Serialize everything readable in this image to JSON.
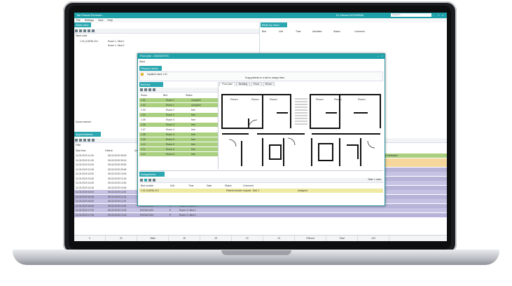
{
  "app": {
    "title": "Tab Pascal Schemer...",
    "menu": [
      "File",
      "Settings",
      "View",
      "Help"
    ],
    "user_label": "Dr. Kalman KATHARINA",
    "search_placeholder": "Search...",
    "accent": "#1ea0a8"
  },
  "left_panel": {
    "title": "Ward view",
    "filter_label": "Ward code",
    "tree_item": "1.01 (CARE) 012",
    "tree_sub": [
      "Room 1 / Bed 1",
      "Room 1 / Bed 2"
    ],
    "footer": "Doctor zimmer"
  },
  "right_panel": {
    "title": "Beds by room",
    "headers": [
      "Bed",
      "Unit",
      "Time",
      "Admitted",
      "Status",
      "Comment"
    ]
  },
  "bottom_panel": {
    "title": "Appointments",
    "filter_label": "Filter",
    "header": [
      "Start time",
      "Patient",
      "Unit"
    ],
    "rows": [
      [
        "11.03.2019 11:00",
        "05.02.2019 09:00",
        "",
        "",
        ""
      ],
      [
        "11.03.2019 11:30",
        "05.02.2019 09:15",
        "",
        "",
        ""
      ],
      [
        "11.03.2019 12:00",
        "05.02.2019 09:30",
        "",
        "",
        ""
      ],
      [
        "11.03.2019 12:30",
        "05.02.2019 09:45",
        "",
        "",
        ""
      ],
      [
        "11.03.2019 13:00",
        "05.02.2019 10:00",
        "",
        "",
        ""
      ],
      [
        "11.03.2019 13:30",
        "05.02.2019 10:15",
        "",
        "",
        ""
      ],
      [
        "11.03.2019 14:00",
        "05.02.2019 10:30",
        "",
        "",
        ""
      ],
      [
        "11.03.2019 14:30",
        "05.02.2019 10:45",
        "",
        "",
        ""
      ],
      [
        "11.03.2019 15:00",
        "05.02.2019 11:00",
        "ROOM 2101",
        "9",
        "Room 1 / Bed 1"
      ],
      [
        "11.03.2019 15:30",
        "05.02.2019 11:15",
        "ROOM 2101",
        "9",
        "Room 1 / Bed 2"
      ],
      [
        "11.03.2019 16:00",
        "05.02.2019 11:30",
        "ROOM 2102",
        "9",
        "Room 2 / Bed 1"
      ],
      [
        "11.03.2019 16:30",
        "05.02.2019 11:45",
        "ROOM 2102",
        "9",
        "Room 2 / Bed 2"
      ],
      [
        "11.03.2019 17:00",
        "05.02.2019 12:00",
        "ROOM 2103",
        "9",
        "Room 3 / Bed 1"
      ],
      [
        "11.03.2019 17:30",
        "05.02.2019 12:15",
        "ROOM 2103",
        "9",
        "Room 3 / Bed 2"
      ]
    ],
    "right_values": [
      "Room 2 - Ward 1 Admission",
      "Discharged",
      "Discharged",
      "Transfer",
      "Transfer",
      "Transfer",
      "Transfer",
      "Transfer",
      "Transfer",
      "Transfer",
      "Transfer"
    ]
  },
  "status_bar": [
    "0",
    "21",
    "Table",
    "15",
    "19",
    "21",
    "13",
    "Filtered",
    "Total",
    "123"
  ],
  "dialog": {
    "title": "Floor plan - DIAGNOSTIC",
    "subtitle": "Ward",
    "section": "Planned beds",
    "info_line": "Inpatient ward 1.01",
    "notice": "Drag patients to a bed to assign them",
    "left_title": "Bed list",
    "col_headers": [
      "Room",
      "Bed",
      "Status"
    ],
    "beds": [
      [
        "1.01",
        "Room 1",
        "occupied"
      ],
      [
        "1.02",
        "Room 1",
        "occupied"
      ],
      [
        "1.03",
        "Room 2",
        "free"
      ],
      [
        "1.04",
        "Room 2",
        "free"
      ],
      [
        "1.05",
        "Room 3",
        "free"
      ],
      [
        "1.06",
        "Room 3",
        "free"
      ],
      [
        "1.07",
        "Room 4",
        "free"
      ],
      [
        "1.08",
        "Room 4",
        "free"
      ],
      [
        "1.09",
        "Room 5",
        "free"
      ],
      [
        "1.10",
        "Room 5",
        "free"
      ],
      [
        "1.11",
        "Room 6",
        "free"
      ],
      [
        "1.12",
        "Room 6",
        "free"
      ]
    ],
    "tabs": [
      "Floor plan",
      "Building",
      "Floor",
      "Room"
    ],
    "room_labels": [
      "Room",
      "Room",
      "Room",
      "Room",
      "Room",
      "Room"
    ],
    "lower_title": "Assignment",
    "lower_headers": [
      "Bed number",
      "Unit",
      "Time",
      "Date",
      "Status",
      "Comment"
    ],
    "lower_row": [
      "1.01 (CARE) 012",
      "Patient transfer request - Bed 1",
      "Assigned"
    ],
    "lower_right": "Total: 1 rows"
  }
}
